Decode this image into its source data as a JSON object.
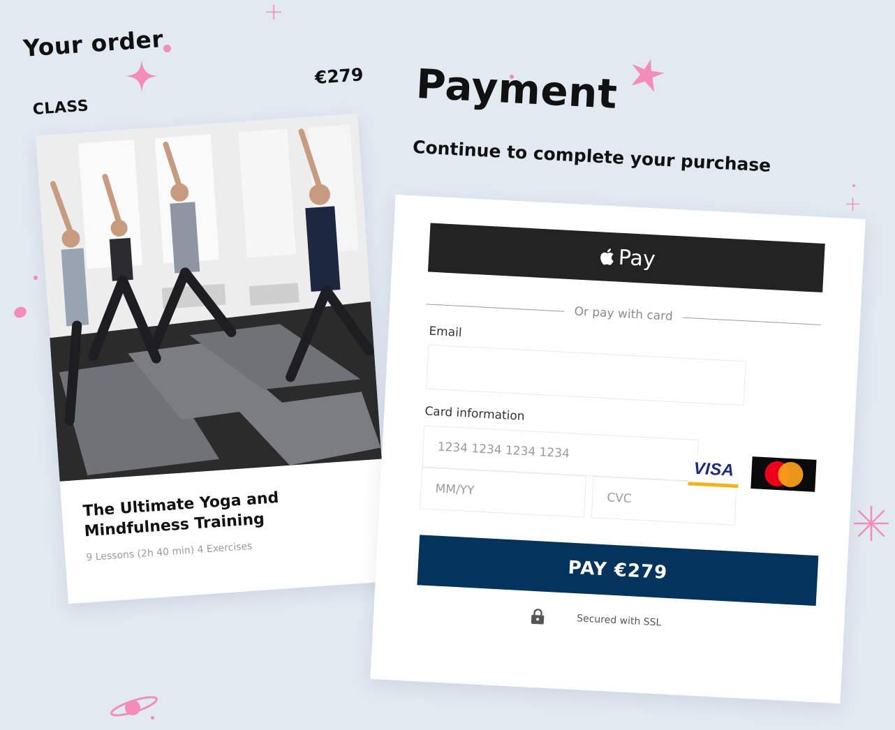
{
  "order": {
    "heading": "Your order",
    "price": "€279",
    "section_label": "CLASS"
  },
  "class_item": {
    "title": "The Ultimate Yoga and Mindfulness Training",
    "meta": "9 Lessons (2h 40 min) 4 Exercises",
    "image_icon": "yoga-class-photo"
  },
  "payment": {
    "title": "Payment",
    "subtitle": "Continue to complete your purchase",
    "apple_pay_label": "Pay",
    "apple_pay_icon": "apple-logo-icon",
    "divider_text": "Or pay with card",
    "email": {
      "label": "Email",
      "value": "",
      "placeholder": ""
    },
    "card": {
      "label": "Card information",
      "number_placeholder": "1234 1234 1234 1234",
      "expiry_placeholder": "MM/YY",
      "cvc_placeholder": "CVC",
      "brands": [
        "VISA",
        "mastercard"
      ]
    },
    "pay_button": "PAY €279",
    "secure_text": "Secured with SSL",
    "secure_icon": "lock-icon"
  },
  "colors": {
    "background": "#e1e9f1",
    "accent_pink": "#f48cb8",
    "pay_button": "#04345c",
    "apple_pay": "#232323"
  }
}
